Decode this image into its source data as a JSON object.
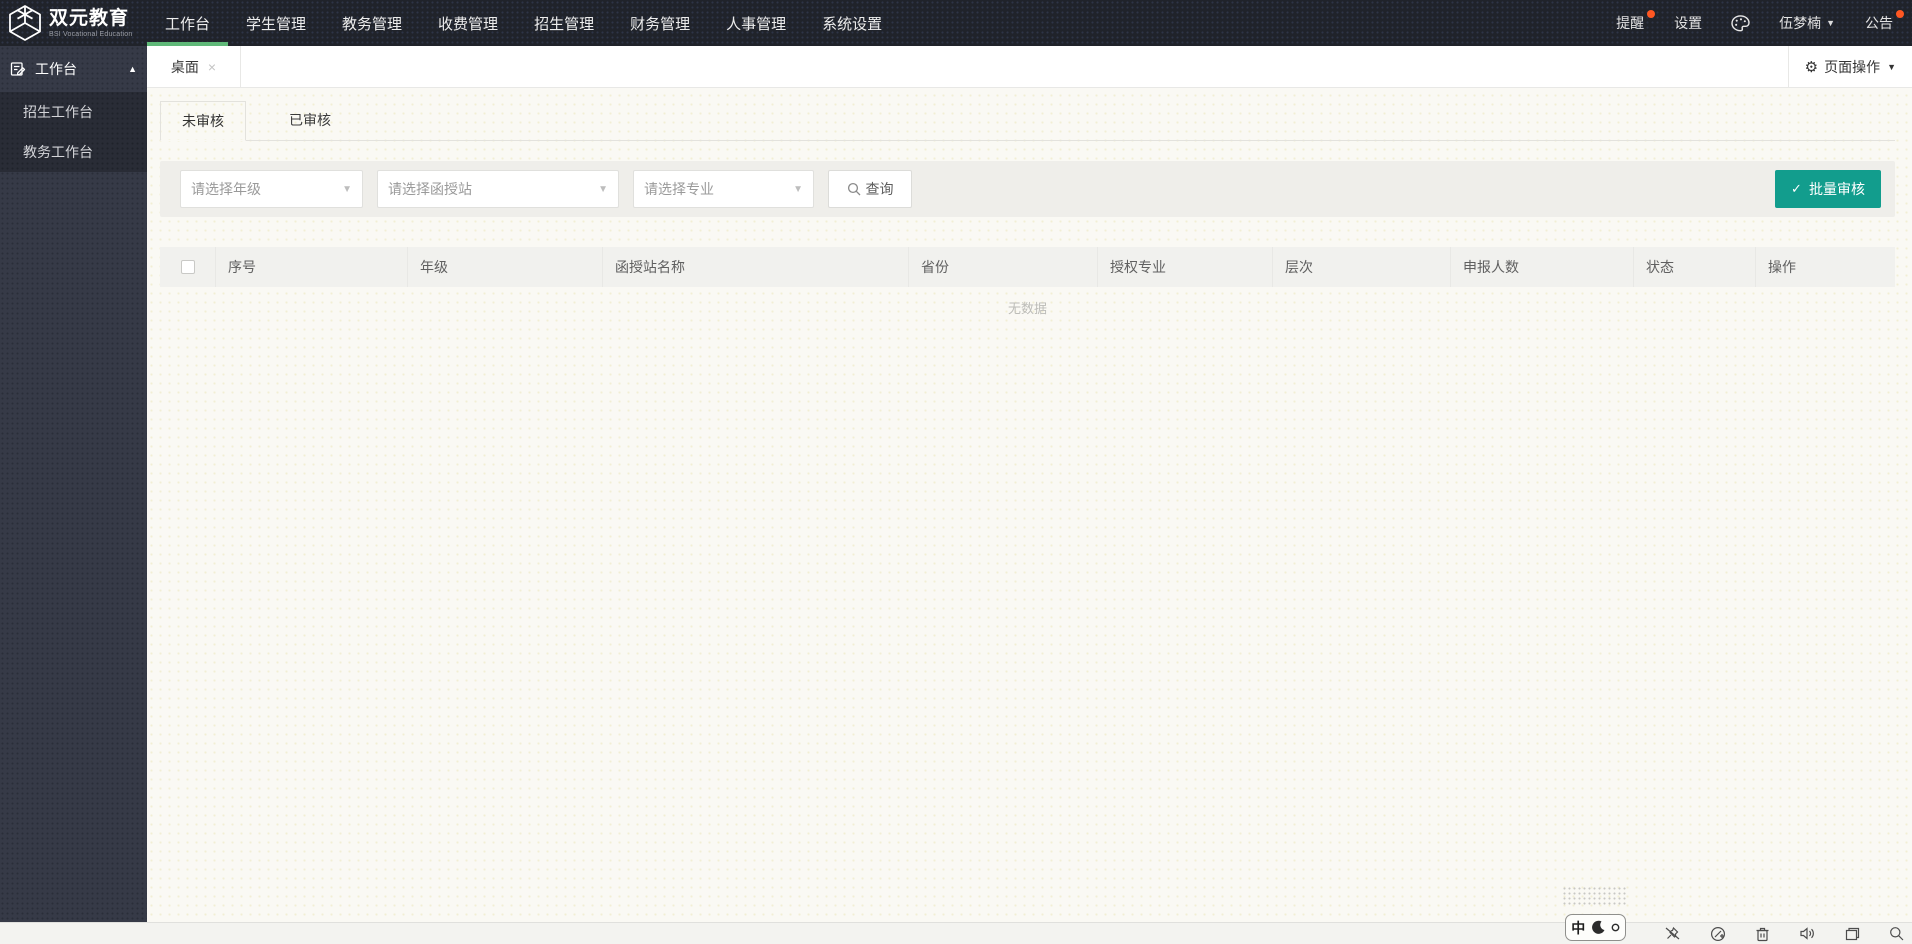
{
  "colors": {
    "accent": "#5FB878",
    "primary": "#129d8d",
    "notify_dot": "#ff5722"
  },
  "brand": {
    "name": "双元教育",
    "subtitle": "BSI Vocational Education"
  },
  "topnav": {
    "items": [
      {
        "label": "工作台",
        "active": true
      },
      {
        "label": "学生管理",
        "active": false
      },
      {
        "label": "教务管理",
        "active": false
      },
      {
        "label": "收费管理",
        "active": false
      },
      {
        "label": "招生管理",
        "active": false
      },
      {
        "label": "财务管理",
        "active": false
      },
      {
        "label": "人事管理",
        "active": false
      },
      {
        "label": "系统设置",
        "active": false
      }
    ]
  },
  "topbar_right": {
    "notice_label": "提醒",
    "settings_label": "设置",
    "user_name": "伍梦楠",
    "announcement_label": "公告"
  },
  "sidebar": {
    "parent_label": "工作台",
    "children": [
      {
        "label": "招生工作台"
      },
      {
        "label": "教务工作台"
      }
    ]
  },
  "tabbar": {
    "active_tab": "桌面",
    "page_actions_label": "页面操作"
  },
  "content": {
    "view_tabs": [
      {
        "label": "未审核",
        "active": true
      },
      {
        "label": "已审核",
        "active": false
      }
    ],
    "filters": [
      {
        "placeholder": "请选择年级"
      },
      {
        "placeholder": "请选择函授站"
      },
      {
        "placeholder": "请选择专业"
      }
    ],
    "query_label": "查询",
    "batch_review_label": "批量审核",
    "table": {
      "columns": [
        "序号",
        "年级",
        "函授站名称",
        "省份",
        "授权专业",
        "层次",
        "申报人数",
        "状态",
        "操作"
      ],
      "rows": [],
      "empty_text": "无数据"
    }
  },
  "taskbar": {
    "ime_lang": "中"
  },
  "ui": {
    "caret_down": "▼",
    "caret_up": "▲",
    "caret_small": "▾",
    "check": "✓",
    "close": "×",
    "gear": "⚙"
  }
}
